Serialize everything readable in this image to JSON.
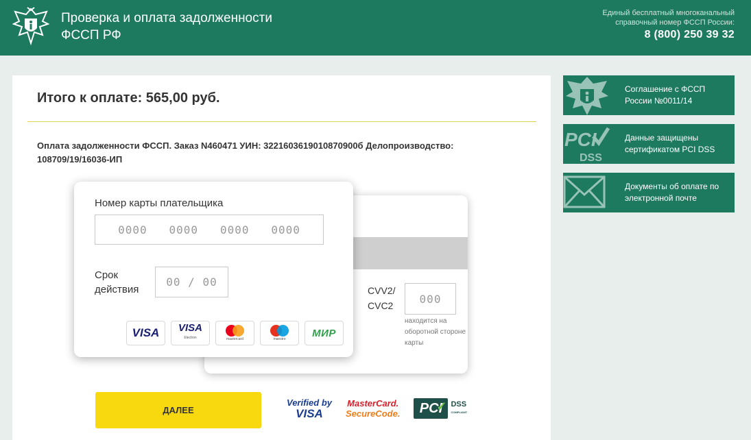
{
  "header": {
    "title": "Проверка и оплата задолженности ФССП РФ",
    "hotline_text": "Единый бесплатный многоканальный справочный номер ФССП России:",
    "phone": "8 (800) 250 39 32"
  },
  "payment": {
    "total": "Итого к оплате: 565,00 руб.",
    "order_description": "Оплата задолженности ФССП. Заказ N460471 УИН: 3221603619010870900б Делопроизводство: 108709/19/16036-ИП"
  },
  "card_form": {
    "card_number_label": "Номер карты плательщика",
    "card_number_placeholder": "0000   0000   0000   0000",
    "expiry_label": "Срок действия",
    "expiry_placeholder": "00 / 00",
    "cvv_label": "CVV2/ CVC2",
    "cvv_placeholder": "000",
    "cvv_hint": "находится на оборотной стороне карты"
  },
  "brands": [
    {
      "name": "VISA",
      "icon": "visa-logo"
    },
    {
      "name": "VISA",
      "sub": "Electron",
      "icon": "visa-electron-logo"
    },
    {
      "sub": "mastercard",
      "icon": "mastercard-logo"
    },
    {
      "sub": "maestro",
      "icon": "maestro-logo"
    },
    {
      "name": "МИР",
      "icon": "mir-logo"
    }
  ],
  "actions": {
    "next_label": "ДАЛЕЕ"
  },
  "security_logos": {
    "vbv_top": "Verified by",
    "vbv_bottom": "VISA",
    "mcsc_top": "MasterCard.",
    "mcsc_bottom": "SecureCode.",
    "pci": "PCI",
    "dss": "DSS",
    "dss_sub": "COMPLIANT"
  },
  "sidebar": {
    "items": [
      {
        "label": "Соглашение с ФССП России №0011/14",
        "icon": "fssp-emblem-icon"
      },
      {
        "label": "Данные защищены сертификатом PCI DSS",
        "icon": "pci-dss-icon"
      },
      {
        "label": "Документы об оплате по электронной почте",
        "icon": "envelope-icon"
      }
    ]
  }
}
